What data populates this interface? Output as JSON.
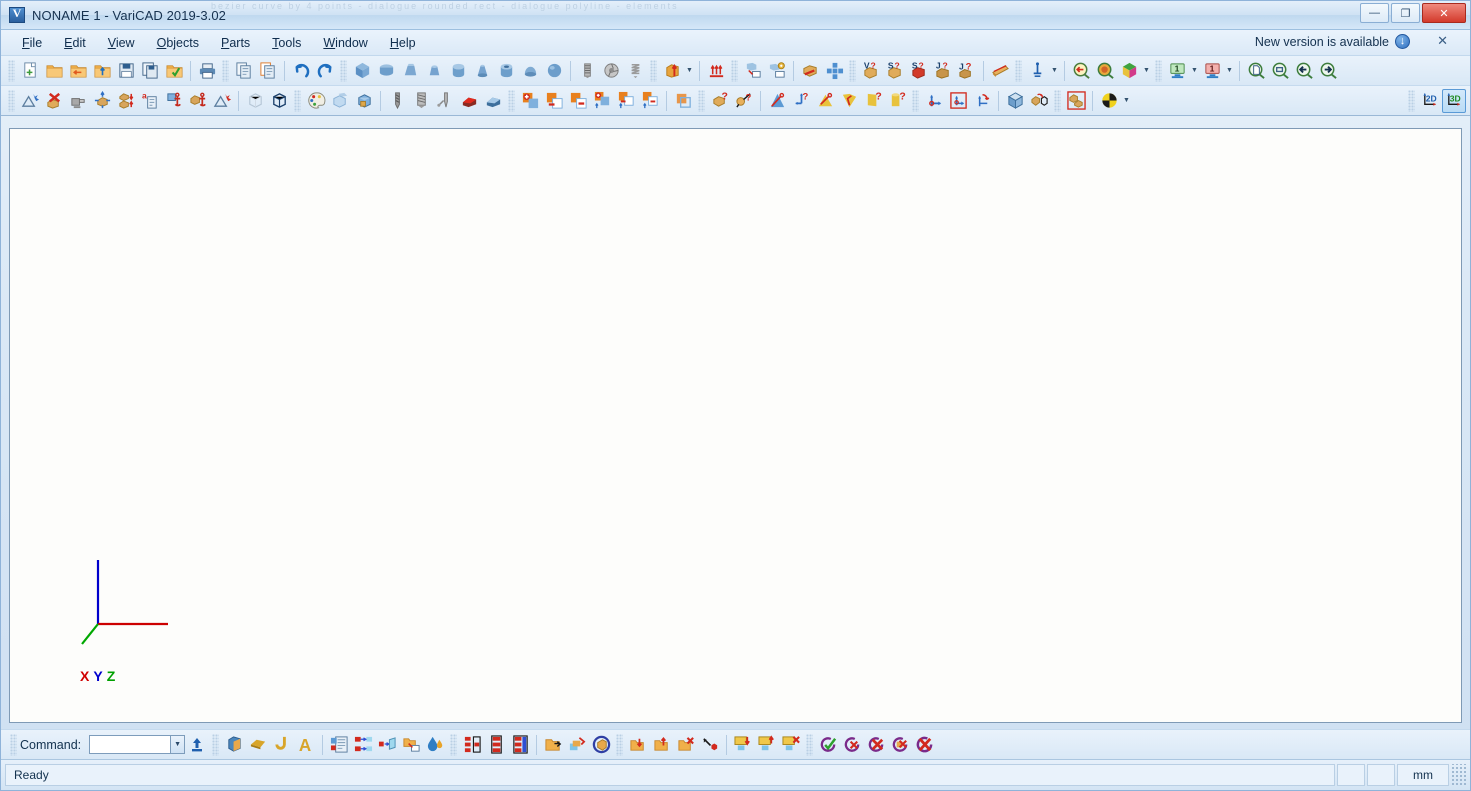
{
  "window": {
    "title": "NONAME 1 - VariCAD 2019-3.02",
    "app_icon": "varicad-logo-icon",
    "minimize_label": "—",
    "maximize_label": "❐",
    "close_label": "✕",
    "ghost_overlay": "bezier curve by 4 points - dialogue    rounded rect - dialogue    polyline - elements"
  },
  "menubar": {
    "items": [
      {
        "label": "File",
        "mnemonic": "F"
      },
      {
        "label": "Edit",
        "mnemonic": "E"
      },
      {
        "label": "View",
        "mnemonic": "V"
      },
      {
        "label": "Objects",
        "mnemonic": "O"
      },
      {
        "label": "Parts",
        "mnemonic": "P"
      },
      {
        "label": "Tools",
        "mnemonic": "T"
      },
      {
        "label": "Window",
        "mnemonic": "W"
      },
      {
        "label": "Help",
        "mnemonic": "H"
      }
    ],
    "notification": {
      "text": "New version is available",
      "icon": "download-arrow-icon",
      "close_label": "✕"
    }
  },
  "toolbar_top": {
    "groups": [
      {
        "name": "file",
        "buttons": [
          {
            "name": "new-file-button",
            "icon": "new-document-icon"
          },
          {
            "name": "open-file-button",
            "icon": "open-folder-icon"
          },
          {
            "name": "open-recent-button",
            "icon": "folder-left-arrow-icon"
          },
          {
            "name": "import-button",
            "icon": "folder-up-arrow-icon"
          },
          {
            "name": "save-button",
            "icon": "floppy-disk-icon"
          },
          {
            "name": "save-as-button",
            "icon": "save-copy-icon"
          },
          {
            "name": "save-all-button",
            "icon": "folder-check-icon"
          }
        ]
      },
      {
        "name": "print",
        "buttons": [
          {
            "name": "print-button",
            "icon": "printer-icon"
          }
        ]
      },
      {
        "name": "clipboard",
        "buttons": [
          {
            "name": "copy-button",
            "icon": "copy-icon"
          },
          {
            "name": "paste-button",
            "icon": "paste-icon"
          }
        ]
      },
      {
        "name": "history",
        "buttons": [
          {
            "name": "undo-button",
            "icon": "undo-arrow-icon"
          },
          {
            "name": "redo-button",
            "icon": "redo-arrow-icon"
          }
        ]
      },
      {
        "name": "solids",
        "buttons": [
          {
            "name": "box-solid-button",
            "icon": "box-icon"
          },
          {
            "name": "prism-solid-button",
            "icon": "prism-icon"
          },
          {
            "name": "wedge-solid-button",
            "icon": "wedge-icon"
          },
          {
            "name": "frustum-solid-button",
            "icon": "frustum-icon"
          },
          {
            "name": "cylinder-solid-button",
            "icon": "cylinder-icon"
          },
          {
            "name": "cone-solid-button",
            "icon": "cone-icon"
          },
          {
            "name": "tube-solid-button",
            "icon": "tube-icon"
          },
          {
            "name": "dome-solid-button",
            "icon": "dome-icon"
          },
          {
            "name": "sphere-solid-button",
            "icon": "sphere-icon"
          }
        ]
      },
      {
        "name": "threads",
        "buttons": [
          {
            "name": "thread-button",
            "icon": "thread-icon"
          },
          {
            "name": "washer-button",
            "icon": "washer-icon"
          },
          {
            "name": "spring-button",
            "icon": "spring-icon"
          }
        ]
      },
      {
        "name": "extrude",
        "buttons": [
          {
            "name": "extrude-button",
            "icon": "extrude-up-icon",
            "has_dropdown": true
          }
        ]
      },
      {
        "name": "loft",
        "buttons": [
          {
            "name": "multi-extrude-button",
            "icon": "multi-arrow-icon"
          }
        ]
      },
      {
        "name": "view-ops",
        "buttons": [
          {
            "name": "project-view-button",
            "icon": "solid-to-view-icon"
          },
          {
            "name": "settings-view-button",
            "icon": "solid-to-view-gear-icon"
          }
        ]
      },
      {
        "name": "section",
        "buttons": [
          {
            "name": "section-button",
            "icon": "cut-solid-icon"
          },
          {
            "name": "pattern-button",
            "icon": "array-pattern-icon"
          }
        ]
      },
      {
        "name": "queries",
        "buttons": [
          {
            "name": "volume-query-button",
            "icon": "volume-question-icon",
            "badge": "V?"
          },
          {
            "name": "surface-query-button",
            "icon": "surface-question-icon",
            "badge": "S?"
          },
          {
            "name": "mass-query-button",
            "icon": "mass-question-icon",
            "badge": "S?"
          },
          {
            "name": "moment-query-button",
            "icon": "inertia-question-icon",
            "badge": "J?"
          },
          {
            "name": "info-query-button",
            "icon": "object-info-icon",
            "badge": "J?"
          }
        ]
      },
      {
        "name": "material",
        "buttons": [
          {
            "name": "material-button",
            "icon": "material-bar-icon"
          }
        ]
      },
      {
        "name": "measure",
        "buttons": [
          {
            "name": "measure-button",
            "icon": "measure-tool-icon",
            "has_dropdown": true
          }
        ]
      },
      {
        "name": "zoomtools",
        "buttons": [
          {
            "name": "zoom-previous-button",
            "icon": "magnifier-back-icon"
          },
          {
            "name": "zoom-color-button",
            "icon": "magnifier-color-icon"
          },
          {
            "name": "render-mode-button",
            "icon": "color-cube-icon",
            "has_dropdown": true
          }
        ]
      },
      {
        "name": "layers",
        "buttons": [
          {
            "name": "layer-green-button",
            "icon": "monitor-green-icon",
            "badge": "1",
            "has_dropdown": true
          },
          {
            "name": "layer-red-button",
            "icon": "monitor-red-icon",
            "badge": "1",
            "has_dropdown": true
          }
        ]
      },
      {
        "name": "navigate",
        "buttons": [
          {
            "name": "zoom-fit-button",
            "icon": "zoom-page-icon"
          },
          {
            "name": "zoom-window-button",
            "icon": "zoom-window-icon"
          },
          {
            "name": "zoom-back-button",
            "icon": "zoom-left-icon"
          },
          {
            "name": "zoom-forward-button",
            "icon": "zoom-right-icon"
          }
        ]
      }
    ]
  },
  "toolbar_second": {
    "groups": [
      {
        "name": "selection",
        "buttons": [
          {
            "name": "select-solid-button",
            "icon": "select-blue-star-icon"
          },
          {
            "name": "delete-solid-button",
            "icon": "delete-red-x-icon"
          },
          {
            "name": "move-solid-button",
            "icon": "grab-hand-icon"
          },
          {
            "name": "translate-button",
            "icon": "move-arrows-icon"
          },
          {
            "name": "mirror-button",
            "icon": "mirror-updown-icon"
          },
          {
            "name": "rename-button",
            "icon": "rename-a-icon"
          },
          {
            "name": "anchor-button",
            "icon": "anchor-blue-icon"
          },
          {
            "name": "anchor-solid-button",
            "icon": "anchor-gold-icon"
          },
          {
            "name": "select-all-button",
            "icon": "select-red-star-icon"
          }
        ]
      },
      {
        "name": "display",
        "buttons": [
          {
            "name": "wireframe-button",
            "icon": "wireframe-cube-icon"
          },
          {
            "name": "edges-button",
            "icon": "outline-cube-icon"
          }
        ]
      },
      {
        "name": "appearance",
        "buttons": [
          {
            "name": "color-palette-button",
            "icon": "palette-icon"
          },
          {
            "name": "transparency-button",
            "icon": "transparent-cube-icon"
          },
          {
            "name": "shade-button",
            "icon": "shaded-cube-icon"
          }
        ]
      },
      {
        "name": "machining",
        "buttons": [
          {
            "name": "drill-button",
            "icon": "drill-bit-icon"
          },
          {
            "name": "mill-button",
            "icon": "mill-cutter-icon"
          },
          {
            "name": "tap-button",
            "icon": "tap-tool-icon"
          },
          {
            "name": "red-surface-button",
            "icon": "red-surface-icon"
          },
          {
            "name": "blue-surface-button",
            "icon": "blue-surface-icon"
          }
        ]
      },
      {
        "name": "boolean",
        "buttons": [
          {
            "name": "union-button",
            "icon": "boolean-add-icon"
          },
          {
            "name": "subtract-button",
            "icon": "boolean-subtract-icon"
          },
          {
            "name": "intersect-button",
            "icon": "boolean-intersect-icon"
          },
          {
            "name": "union-copy-button",
            "icon": "boolean-add-copy-icon"
          },
          {
            "name": "subtract-copy-button",
            "icon": "boolean-subtract-copy-icon"
          },
          {
            "name": "intersect-copy-button",
            "icon": "boolean-intersect-copy-icon"
          }
        ]
      },
      {
        "name": "copyops",
        "buttons": [
          {
            "name": "copy-solid-button",
            "icon": "copy-solid-icon"
          }
        ]
      },
      {
        "name": "queries2",
        "buttons": [
          {
            "name": "identify-button",
            "icon": "solid-question-icon"
          },
          {
            "name": "dimension-query-button",
            "icon": "dimension-question-icon"
          }
        ]
      },
      {
        "name": "measures",
        "buttons": [
          {
            "name": "distance-button",
            "icon": "distance-arrow-icon"
          },
          {
            "name": "coord-query-button",
            "icon": "coordinate-question-icon"
          },
          {
            "name": "angle-button",
            "icon": "angle-question-icon"
          },
          {
            "name": "area-button",
            "icon": "area-question-icon"
          },
          {
            "name": "arc-button",
            "icon": "arc-question-icon"
          },
          {
            "name": "volume2-button",
            "icon": "volume2-question-icon"
          }
        ]
      },
      {
        "name": "coords",
        "buttons": [
          {
            "name": "ucs-button",
            "icon": "ucs-axes-icon"
          },
          {
            "name": "ucs-set-button",
            "icon": "ucs-set-icon"
          },
          {
            "name": "ucs-rotate-button",
            "icon": "ucs-rotate-icon"
          }
        ]
      },
      {
        "name": "assembly",
        "buttons": [
          {
            "name": "assembly-button",
            "icon": "assembly-cube-icon"
          },
          {
            "name": "explode-button",
            "icon": "explode-cube-icon"
          }
        ]
      },
      {
        "name": "group",
        "buttons": [
          {
            "name": "group-button",
            "icon": "group-solids-icon"
          }
        ]
      },
      {
        "name": "shading",
        "buttons": [
          {
            "name": "light-button",
            "icon": "light-pie-icon",
            "has_dropdown": true
          }
        ]
      }
    ],
    "mode_buttons": [
      {
        "name": "mode-2d-button",
        "label": "2D",
        "active": false
      },
      {
        "name": "mode-3d-button",
        "label": "3D",
        "active": true
      }
    ]
  },
  "canvas": {
    "axes": {
      "x_label": "X",
      "y_label": "Y",
      "z_label": "Z",
      "x_color": "#d00000",
      "y_color": "#0000cc",
      "z_color": "#00a000"
    },
    "background_color": "#fdfdfb"
  },
  "bottom_toolbar": {
    "command_label": "Command:",
    "command_value": "",
    "command_placeholder": "",
    "dropdown_icon": "chevron-down-icon",
    "export_icon": "export-up-icon",
    "groups": [
      {
        "name": "2d-objects",
        "buttons": [
          {
            "name": "solid-2d-button",
            "icon": "blue-solid-icon"
          },
          {
            "name": "gold-shape-button",
            "icon": "gold-wedge-icon"
          },
          {
            "name": "gold-hook-button",
            "icon": "gold-hook-icon"
          },
          {
            "name": "text-button",
            "icon": "letter-a-icon"
          }
        ]
      },
      {
        "name": "lists",
        "buttons": [
          {
            "name": "bom-button",
            "icon": "bom-list-icon"
          },
          {
            "name": "transfer-button",
            "icon": "transfer-arrows-icon"
          },
          {
            "name": "export-data-button",
            "icon": "export-data-icon"
          },
          {
            "name": "open-export-button",
            "icon": "folder-export-icon"
          },
          {
            "name": "drop-button",
            "icon": "water-drop-icon"
          }
        ]
      },
      {
        "name": "layers2",
        "buttons": [
          {
            "name": "layer-list-button",
            "icon": "layer-stack-icon"
          },
          {
            "name": "layer-manage-button",
            "icon": "layer-manage-icon"
          },
          {
            "name": "layer-settings-button",
            "icon": "layer-settings-icon"
          }
        ]
      },
      {
        "name": "blocks",
        "buttons": [
          {
            "name": "block-insert-button",
            "icon": "block-insert-icon"
          },
          {
            "name": "block-edit-button",
            "icon": "block-edit-icon"
          },
          {
            "name": "block-circle-button",
            "icon": "block-circle-icon"
          }
        ]
      },
      {
        "name": "blockops",
        "buttons": [
          {
            "name": "block-down-button",
            "icon": "folder-down-icon"
          },
          {
            "name": "block-up-button",
            "icon": "folder-up2-icon"
          },
          {
            "name": "block-delete-button",
            "icon": "folder-delete-icon"
          },
          {
            "name": "block-point-button",
            "icon": "point-arrow-icon"
          }
        ]
      },
      {
        "name": "screens",
        "buttons": [
          {
            "name": "screen-down-button",
            "icon": "screen-down-icon"
          },
          {
            "name": "screen-up-button",
            "icon": "screen-up-icon"
          },
          {
            "name": "screen-delete-button",
            "icon": "screen-delete-icon"
          }
        ]
      },
      {
        "name": "confirm",
        "buttons": [
          {
            "name": "accept-button",
            "icon": "circle-check-icon"
          },
          {
            "name": "cancel1-button",
            "icon": "circle-x1-icon"
          },
          {
            "name": "cancel2-button",
            "icon": "circle-x2-icon"
          },
          {
            "name": "cancel3-button",
            "icon": "circle-x3-icon"
          },
          {
            "name": "cancel4-button",
            "icon": "circle-x4-icon"
          }
        ]
      }
    ]
  },
  "statusbar": {
    "message": "Ready",
    "cell_1": "",
    "cell_2": "",
    "units": "mm"
  }
}
